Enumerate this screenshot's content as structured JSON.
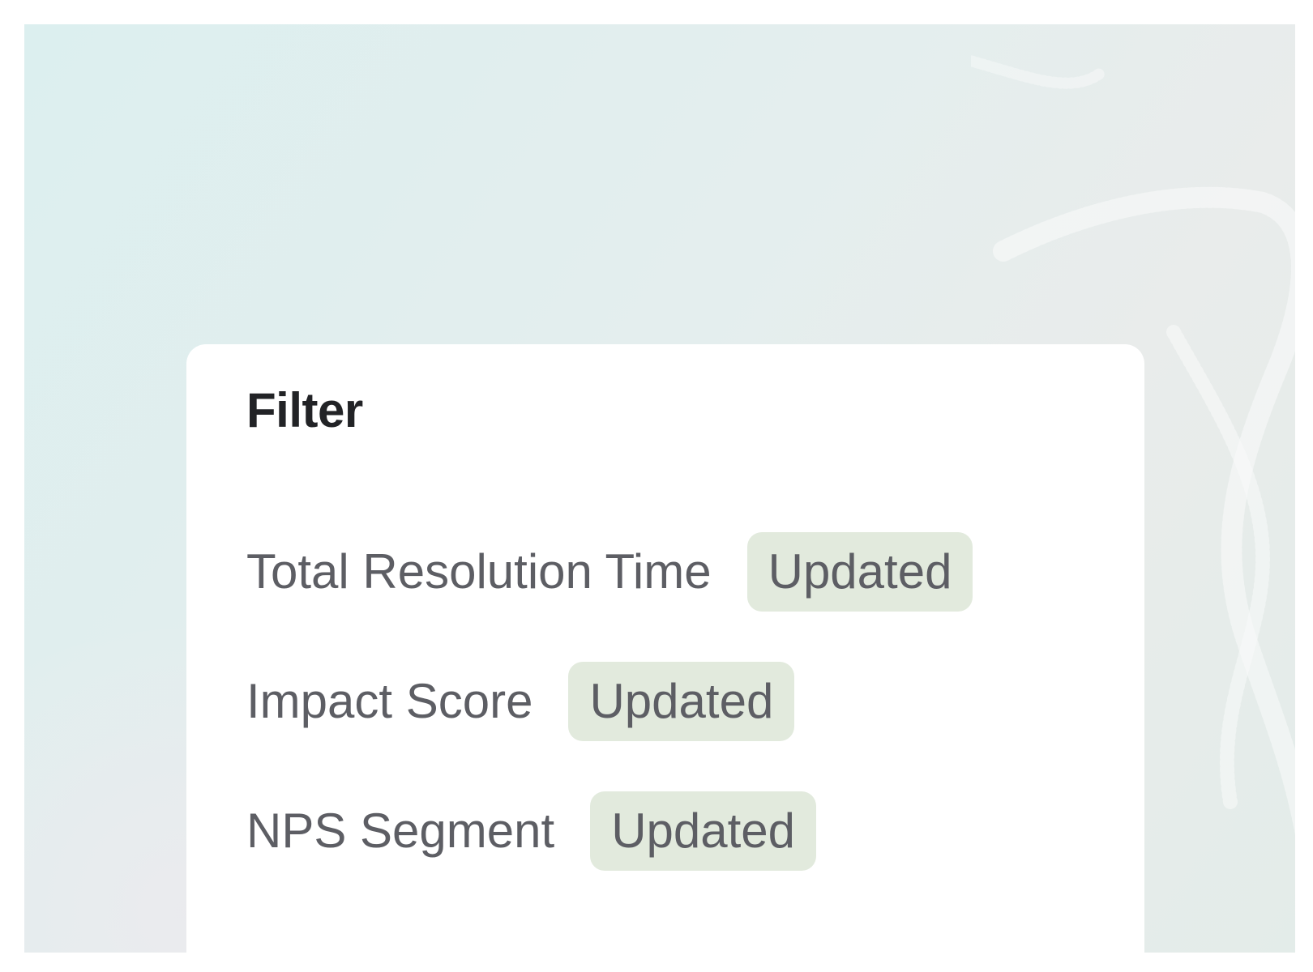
{
  "panel": {
    "title": "Filter",
    "filters": [
      {
        "label": "Total Resolution Time",
        "status": "Updated"
      },
      {
        "label": "Impact Score",
        "status": "Updated"
      },
      {
        "label": "NPS Segment",
        "status": "Updated"
      }
    ]
  },
  "colors": {
    "card_bg": "#ffffff",
    "title_text": "#222326",
    "label_text": "#5d5e64",
    "badge_bg": "#e2eadd",
    "backdrop_start": "#dcefef",
    "backdrop_end": "#e3ece9"
  }
}
